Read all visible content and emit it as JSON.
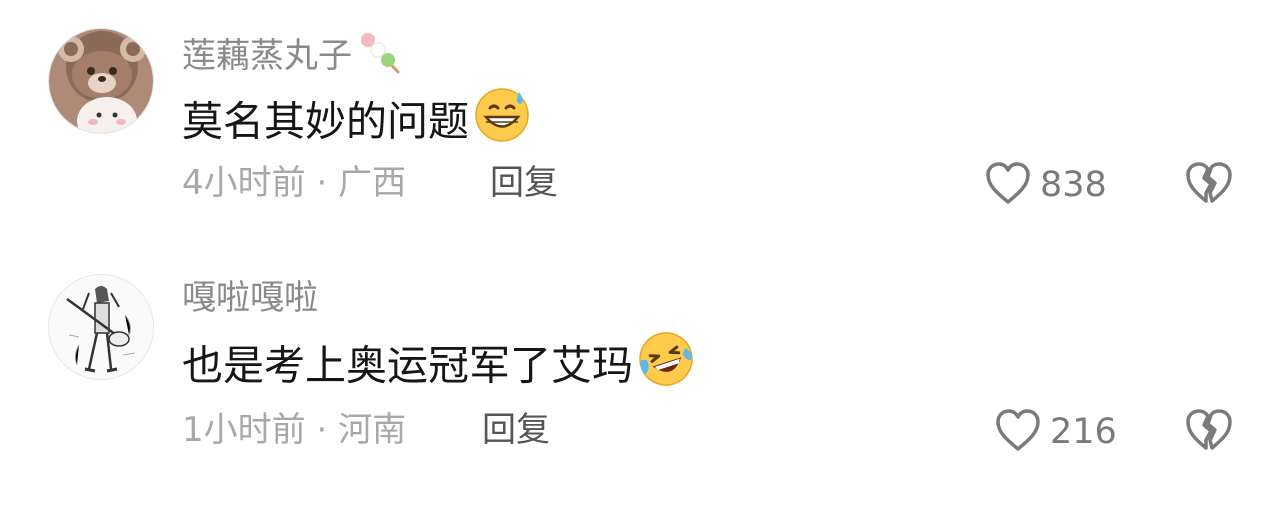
{
  "comments": [
    {
      "username": "莲藕蒸丸子",
      "username_emoji": "dango-icon",
      "avatar": "bear-avatar",
      "text": "莫名其妙的问题",
      "text_emoji": "grinning-sweat-emoji",
      "time": "4小时前",
      "separator": " · ",
      "location": "广西",
      "reply_label": "回复",
      "likes": "838"
    },
    {
      "username": "嘎啦嘎啦",
      "avatar": "sketch-figure-avatar",
      "text": "也是考上奥运冠军了艾玛",
      "text_emoji": "laughing-tears-emoji",
      "time": "1小时前",
      "separator": " · ",
      "location": "河南",
      "reply_label": "回复",
      "likes": "216"
    }
  ],
  "icons": {
    "like": "heart-outline-icon",
    "dislike": "broken-heart-icon"
  },
  "colors": {
    "username": "#8a8a8a",
    "content": "#161616",
    "meta": "#a8a8a8",
    "reply": "#555555",
    "icon": "#7a7a7a"
  }
}
